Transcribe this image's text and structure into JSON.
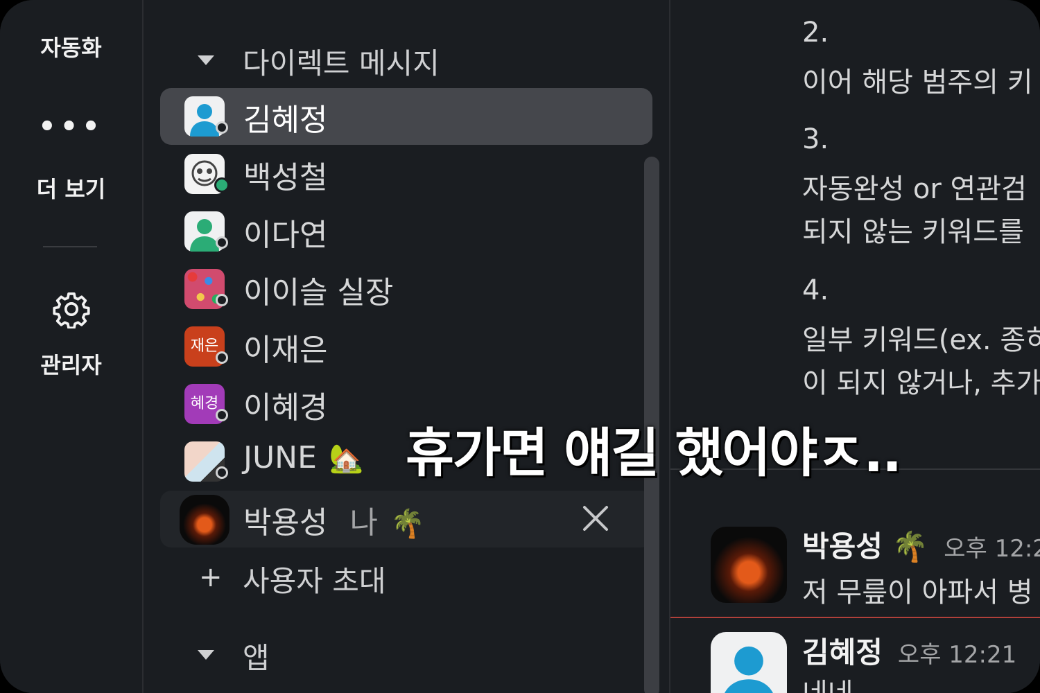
{
  "rail": {
    "automation_label": "자동화",
    "more_icon": "more-dots-icon",
    "more_label": "더 보기",
    "admin_icon": "gear-icon",
    "admin_label": "관리자"
  },
  "sidebar": {
    "dm_section_label": "다이렉트 메시지",
    "dms": [
      {
        "name": "김혜정",
        "avatar": "default-person",
        "status": "away"
      },
      {
        "name": "백성철",
        "avatar": "cartoon-face",
        "status": "online"
      },
      {
        "name": "이다연",
        "avatar": "default-person-green",
        "status": "away"
      },
      {
        "name": "이이슬 실장",
        "avatar": "sprinkles",
        "status": "away"
      },
      {
        "name": "이재은",
        "avatar_text": "재은",
        "status": "away"
      },
      {
        "name": "이혜경",
        "avatar_text": "혜경",
        "status": "away"
      },
      {
        "name": "JUNE",
        "emoji": "🏡",
        "status": "away"
      },
      {
        "name": "박용성",
        "suffix": "나",
        "emoji": "🌴",
        "status": "online"
      }
    ],
    "invite_label": "사용자 초대",
    "apps_section_label": "앱",
    "colors": {
      "active_row": "#45474c",
      "online": "#2bac76",
      "jaeeun_bg": "#c9401c",
      "hyekyung_bg": "#a23bb8"
    }
  },
  "pane": {
    "lines": [
      "2.",
      "이어 해당 범주의 키",
      "3.",
      "자동완성 or 연관검",
      "되지 않는 키워드를",
      "4.",
      "일부 키워드(ex. 종히",
      "이 되지 않거나, 추가"
    ],
    "messages": [
      {
        "sender": "박용성",
        "emoji": "🌴",
        "time": "오후 12:2",
        "text": "저 무릎이 아파서 병"
      },
      {
        "sender": "김혜정",
        "time": "오후 12:21",
        "text": "네네"
      }
    ]
  },
  "caption": "휴가면 얘길 했어야ㅈ.."
}
